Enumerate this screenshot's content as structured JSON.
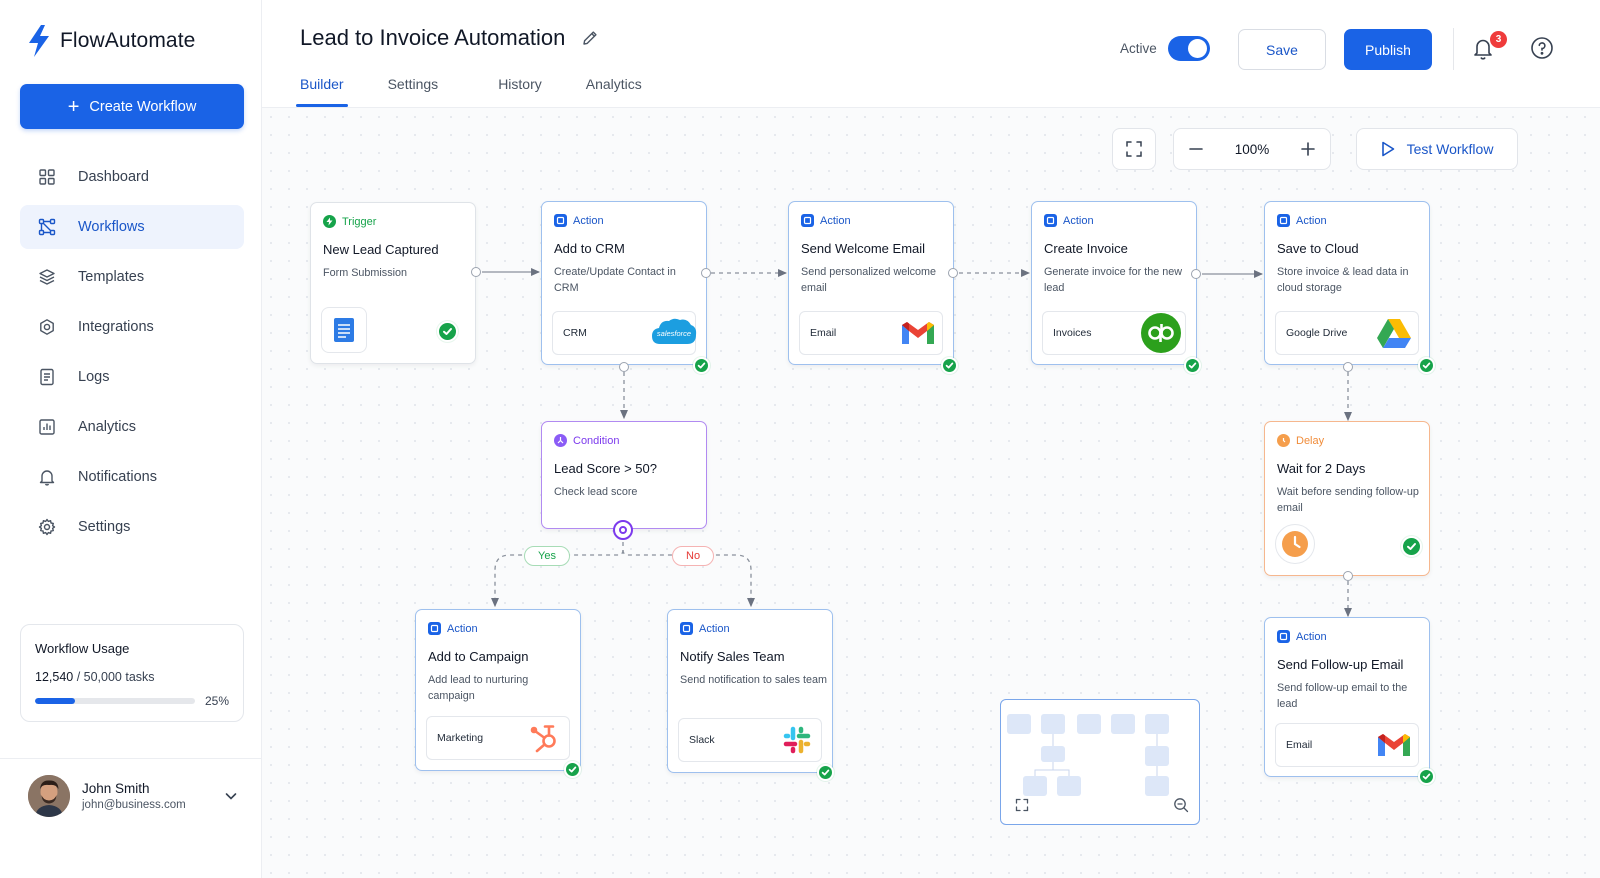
{
  "app": {
    "name": "FlowAutomate",
    "create_label": "Create Workflow"
  },
  "sidebar": {
    "items": [
      {
        "label": "Dashboard",
        "icon": "grid-icon"
      },
      {
        "label": "Workflows",
        "icon": "workflow-icon",
        "active": true
      },
      {
        "label": "Templates",
        "icon": "layers-icon"
      },
      {
        "label": "Integrations",
        "icon": "puzzle-icon"
      },
      {
        "label": "Logs",
        "icon": "document-icon"
      },
      {
        "label": "Analytics",
        "icon": "chart-icon"
      },
      {
        "label": "Notifications",
        "icon": "bell-icon"
      },
      {
        "label": "Settings",
        "icon": "gear-icon"
      }
    ],
    "usage": {
      "title": "Workflow Usage",
      "used": "12,540",
      "total_text": " / 50,000 tasks",
      "percent_label": "25%",
      "percent": 25
    }
  },
  "user": {
    "name": "John Smith",
    "email": "john@business.com"
  },
  "header": {
    "title": "Lead to Invoice Automation",
    "tabs": [
      "Builder",
      "Settings",
      "History",
      "Analytics"
    ],
    "active_tab": "Builder",
    "status_label": "Active",
    "status_on": true,
    "save_label": "Save",
    "publish_label": "Publish",
    "notification_count": "3"
  },
  "toolbar": {
    "zoom": "100%",
    "test_label": "Test Workflow"
  },
  "colors": {
    "primary": "#1a63e6",
    "action": "#1a63e6",
    "trigger": "#16a34a",
    "condition": "#7c3aed",
    "delay": "#f08c3a",
    "success": "#16a34a",
    "yes": "#16a34a",
    "no": "#e53935"
  },
  "nodes": {
    "trigger": {
      "type": "Trigger",
      "title": "New Lead Captured",
      "desc": "Form Submission",
      "icon": "document-icon"
    },
    "crm": {
      "type": "Action",
      "title": "Add to CRM",
      "desc": "Create/Update Contact in CRM",
      "app": "CRM",
      "logo": "salesforce"
    },
    "welcome": {
      "type": "Action",
      "title": "Send Welcome Email",
      "desc": "Send personalized welcome email",
      "app": "Email",
      "logo": "gmail"
    },
    "invoice": {
      "type": "Action",
      "title": "Create Invoice",
      "desc": "Generate invoice for the new lead",
      "app": "Invoices",
      "logo": "quickbooks"
    },
    "cloud": {
      "type": "Action",
      "title": "Save to Cloud",
      "desc": "Store invoice & lead data in cloud storage",
      "app": "Google Drive",
      "logo": "google-drive"
    },
    "condition": {
      "type": "Condition",
      "title": "Lead Score > 50?",
      "desc": "Check lead score"
    },
    "campaign": {
      "type": "Action",
      "title": "Add to Campaign",
      "desc": "Add lead to nurturing campaign",
      "app": "Marketing",
      "logo": "hubspot"
    },
    "sales": {
      "type": "Action",
      "title": "Notify Sales Team",
      "desc": "Send notification to sales team",
      "app": "Slack",
      "logo": "slack"
    },
    "delay": {
      "type": "Delay",
      "title": "Wait for 2 Days",
      "desc": "Wait before sending follow-up email",
      "icon": "clock-icon"
    },
    "followup": {
      "type": "Action",
      "title": "Send Follow-up Email",
      "desc": "Send follow-up email to the lead",
      "app": "Email",
      "logo": "gmail"
    }
  },
  "branches": {
    "yes": "Yes",
    "no": "No"
  }
}
